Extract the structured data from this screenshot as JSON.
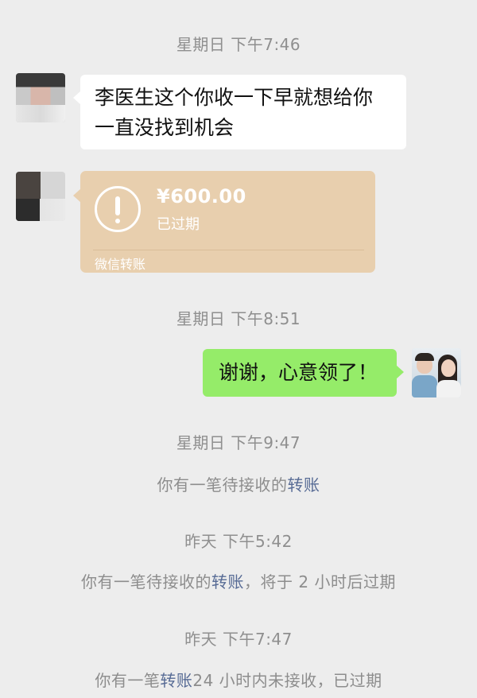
{
  "colors": {
    "background": "#ededed",
    "timestamp_text": "#8f8f8f",
    "link": "#576b95",
    "incoming_bubble": "#ffffff",
    "outgoing_bubble": "#95ec69",
    "transfer_card": "#e8cfae",
    "transfer_text": "#ffffff"
  },
  "messages": {
    "ts1": "星期日 下午7:46",
    "incoming_text_line1": "李医生这个你收一下早就想给你",
    "incoming_text_line2": "一直没找到机会",
    "transfer": {
      "icon": "exclamation-circle-icon",
      "amount": "¥600.00",
      "status": "已过期",
      "footer": "微信转账"
    },
    "ts2": "星期日 下午8:51",
    "outgoing_text": "谢谢，心意领了！",
    "ts3": "星期日 下午9:47",
    "sys1": {
      "prefix": "你有一笔待接收的",
      "link": "转账",
      "suffix": ""
    },
    "ts4": "昨天 下午5:42",
    "sys2": {
      "prefix": "你有一笔待接收的",
      "link": "转账",
      "suffix": "，将于 2 小时后过期"
    },
    "ts5": "昨天 下午7:47",
    "sys3": {
      "prefix": "你有一笔",
      "link": "转账",
      "suffix": "24 小时内未接收，已过期"
    }
  }
}
